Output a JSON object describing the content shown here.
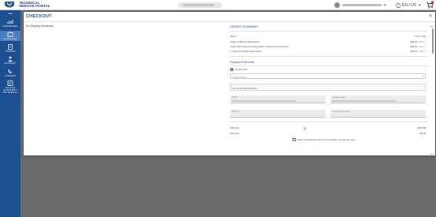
{
  "brand": {
    "line1": "TECHNICAL",
    "line2": "SERVICE PORTAL"
  },
  "header": {
    "language": "EN / US",
    "icons": [
      "mopar-logo",
      "avatar-icon",
      "globe-icon",
      "cart-icon"
    ]
  },
  "sidebar": {
    "items": [
      {
        "label": "DASHBOARD",
        "icon": "dashboard-icon",
        "active": false
      },
      {
        "label": "PURCHASE",
        "icon": "purchase-icon",
        "active": true
      },
      {
        "label": "ORDERS",
        "icon": "orders-icon",
        "active": false
      },
      {
        "label": "ACCOUNT",
        "icon": "account-icon",
        "active": false
      },
      {
        "label": "SUPPORT",
        "icon": "support-icon",
        "active": false
      },
      {
        "label": "VEHICLE AUTHORITY REFERENCE",
        "icon": "reference-icon",
        "active": false
      }
    ],
    "colors": {
      "background": "#1b4f8f",
      "active": "#4b7fc0"
    }
  },
  "modal": {
    "title": "CHECKOUT",
    "close": "×",
    "left": {
      "shipping_note": "No Shipping Necessary"
    },
    "order_summary": {
      "title": "ORDER SUMMARY",
      "col_name": "Name",
      "col_price": "Price / Qty",
      "items": [
        {
          "name": "3 Day of RSO.2 Subscription",
          "price": "$64.00",
          "qty": "each x 1"
        },
        {
          "name": "3 Day Tech Authority Subscription including Service Items",
          "price": "$36.00",
          "qty": "each x 1"
        },
        {
          "name": "1 Year SCU Flash Subscription",
          "price": "$20.00",
          "qty": "each x 1"
        }
      ]
    },
    "payment": {
      "title": "Payment Method",
      "option": "Credit Card",
      "select_placeholder": "Please Select",
      "no_card": "No credit card selected",
      "field_email": "Email *",
      "field_company": "Company Name",
      "field_phone": "Phone # *",
      "field_tax": "Tax ID/VAT (optional)"
    },
    "totals": {
      "subtotal_label": "Subtotal",
      "subtotal_value": "$144.00",
      "discount_label": "Discount",
      "discount_value": "$0.00"
    },
    "terms": "Read our Subscription Terms and Conditions. All sales are final.",
    "accent": "#1b4f8f"
  }
}
